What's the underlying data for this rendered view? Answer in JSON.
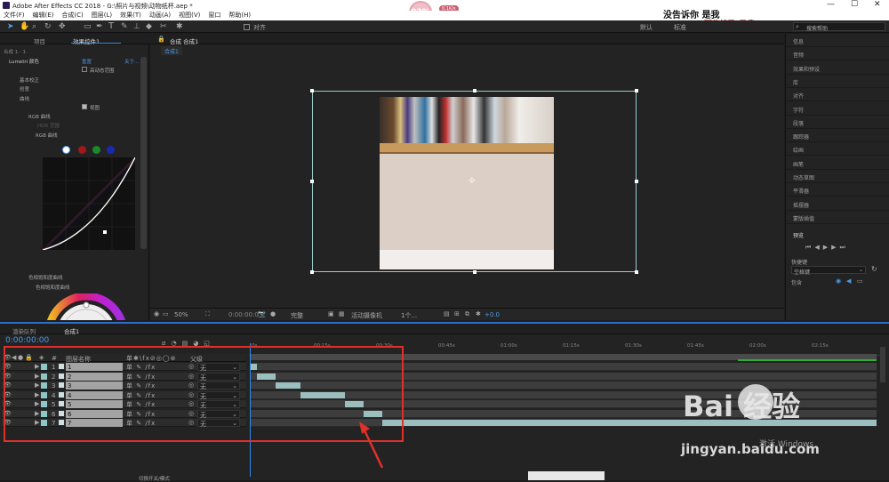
{
  "window": {
    "title": "Adobe After Effects CC 2018 - G:\\照片与视频\\动物纸杯.aep *",
    "badge": "93%",
    "speed": "0.1K/s"
  },
  "watermark": {
    "line1": "没告诉你 是我",
    "line2": "那些情歌 是我",
    "baidu": "Bai 经验",
    "url": "jingyan.baidu.com",
    "windows": "激活 Windows"
  },
  "menu": [
    "文件(F)",
    "编辑(E)",
    "合成(C)",
    "图层(L)",
    "效果(T)",
    "动画(A)",
    "视图(V)",
    "窗口",
    "帮助(H)"
  ],
  "toolbar": {
    "align": "对齐",
    "workspace_default": "默认",
    "workspace_standard": "标准",
    "search_placeholder": "搜索帮助"
  },
  "left_panel": {
    "tabs": [
      "项目",
      "效果控件1",
      "合成 1 · 1"
    ],
    "tree": {
      "effect": "Lumetri 颜色",
      "reset": "重置",
      "about": "关于...",
      "hdr": "高动态范围",
      "basic": "基本校正",
      "creative": "创意",
      "curves": "曲线",
      "rgb_curves": "RGB 曲线",
      "hdr_range": "HDR 范围",
      "rgb_sub": "RGB 曲线",
      "preview": "视图",
      "hue_sat": "色相饱和度曲线",
      "hue_sat_sub": "色相饱和度曲线"
    }
  },
  "comp_panel": {
    "tab": "合成 合成1",
    "subtab": "合成1",
    "zoom": "50%",
    "time": "0:00:00:00",
    "quality": "完整",
    "camera": "活动摄像机",
    "views": "1个...",
    "exposure": "+0.0"
  },
  "right_panel": {
    "items": [
      "信息",
      "音频",
      "效果和预设",
      "库",
      "对齐",
      "字符",
      "段落",
      "跟踪器",
      "绘画",
      "画笔",
      "动态草图",
      "平滑器",
      "摇摆器",
      "蒙版插值"
    ],
    "preview": {
      "title": "预览",
      "shortcut_label": "快捷键",
      "shortcut_value": "空格键",
      "include": "包含"
    }
  },
  "timeline": {
    "tabs": [
      "渲染队列",
      "合成1"
    ],
    "time": "0:00:00:00",
    "col_layer_name": "图层名称",
    "col_parent": "父级",
    "ticks": [
      "0s",
      "00:15s",
      "00:30s",
      "00:45s",
      "01:00s",
      "01:15s",
      "01:30s",
      "01:45s",
      "02:00s",
      "02:15s"
    ],
    "bottom": "切换开关/模式",
    "layers": [
      {
        "num": "1",
        "name": "1",
        "parent": "无",
        "start": 0.0,
        "end": 0.01
      },
      {
        "num": "2",
        "name": "2",
        "parent": "无",
        "start": 0.01,
        "end": 0.04
      },
      {
        "num": "3",
        "name": "3",
        "parent": "无",
        "start": 0.04,
        "end": 0.08
      },
      {
        "num": "4",
        "name": "4",
        "parent": "无",
        "start": 0.08,
        "end": 0.15
      },
      {
        "num": "5",
        "name": "5",
        "parent": "无",
        "start": 0.15,
        "end": 0.18
      },
      {
        "num": "6",
        "name": "6",
        "parent": "无",
        "start": 0.18,
        "end": 0.21
      },
      {
        "num": "7",
        "name": "7",
        "parent": "无",
        "start": 0.21,
        "end": 1.0
      }
    ]
  },
  "colors": {
    "accent": "#2d8ceb",
    "annotation": "#e0302a",
    "clip": "#9bbfbf",
    "label": "#8fc7c7"
  }
}
